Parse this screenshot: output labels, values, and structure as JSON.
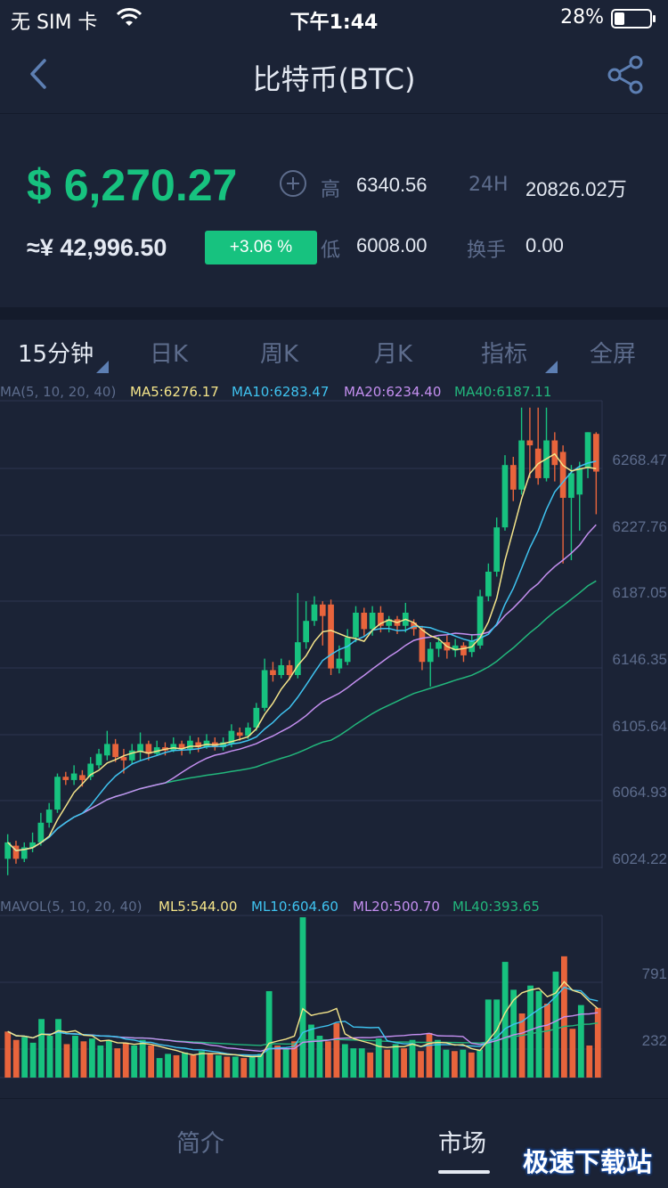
{
  "status_bar": {
    "carrier": "无 SIM 卡",
    "time": "下午1:44",
    "battery_pct": "28%",
    "battery_level": 0.28
  },
  "nav": {
    "title": "比特币(BTC)",
    "back_icon": "chevron-left-icon",
    "share_icon": "share-icon"
  },
  "price": {
    "main": "$ 6,270.27",
    "cny": "≈¥ 42,996.50",
    "change": "+3.06 %",
    "high_label": "高",
    "high_value": "6340.56",
    "low_label": "低",
    "low_value": "6008.00",
    "volume_label": "24H",
    "volume_value": "20826.02万",
    "turnover_label": "换手",
    "turnover_value": "0.00"
  },
  "period_tabs": [
    "15分钟",
    "日K",
    "周K",
    "月K",
    "指标",
    "全屏"
  ],
  "active_period": "15分钟",
  "colors": {
    "bg": "#1b2336",
    "up": "#17c27f",
    "down": "#e8643c",
    "ma5": "#f5e58a",
    "ma10": "#3fc3f0",
    "ma20": "#c48ff0",
    "ma40": "#22b77c",
    "grid": "#2c3650",
    "muted": "#5d6c8c"
  },
  "ma_legend": {
    "label": "MA(5, 10, 20, 40)",
    "ma5": "MA5:6276.17",
    "ma10": "MA10:6283.47",
    "ma20": "MA20:6234.40",
    "ma40": "MA40:6187.11"
  },
  "vol_legend": {
    "label": "MAVOL(5, 10, 20, 40)",
    "ml5": "ML5:544.00",
    "ml10": "ML10:604.60",
    "ml20": "ML20:500.70",
    "ml40": "ML40:393.65"
  },
  "chart_data": {
    "type": "candlestick",
    "price_axis_ticks": [
      "6268.47",
      "6227.76",
      "6187.05",
      "6146.35",
      "6105.64",
      "6064.93",
      "6024.22"
    ],
    "volume_axis_ticks": [
      "791",
      "232"
    ],
    "price_range": [
      6024.22,
      6309.18
    ],
    "volume_range": [
      0,
      1150
    ],
    "candles": [
      {
        "o": 6030,
        "c": 6040,
        "h": 6045,
        "l": 6020
      },
      {
        "o": 6038,
        "c": 6030,
        "h": 6041,
        "l": 6027
      },
      {
        "o": 6030,
        "c": 6037,
        "h": 6040,
        "l": 6028
      },
      {
        "o": 6037,
        "c": 6040,
        "h": 6046,
        "l": 6034
      },
      {
        "o": 6040,
        "c": 6052,
        "h": 6058,
        "l": 6038
      },
      {
        "o": 6052,
        "c": 6060,
        "h": 6064,
        "l": 6049
      },
      {
        "o": 6060,
        "c": 6080,
        "h": 6082,
        "l": 6058
      },
      {
        "o": 6080,
        "c": 6078,
        "h": 6083,
        "l": 6075
      },
      {
        "o": 6078,
        "c": 6082,
        "h": 6087,
        "l": 6075
      },
      {
        "o": 6081,
        "c": 6078,
        "h": 6084,
        "l": 6074
      },
      {
        "o": 6080,
        "c": 6088,
        "h": 6092,
        "l": 6078
      },
      {
        "o": 6087,
        "c": 6094,
        "h": 6097,
        "l": 6085
      },
      {
        "o": 6093,
        "c": 6100,
        "h": 6108,
        "l": 6090
      },
      {
        "o": 6100,
        "c": 6092,
        "h": 6103,
        "l": 6089
      },
      {
        "o": 6092,
        "c": 6090,
        "h": 6097,
        "l": 6082
      },
      {
        "o": 6090,
        "c": 6096,
        "h": 6100,
        "l": 6088
      },
      {
        "o": 6095,
        "c": 6100,
        "h": 6107,
        "l": 6090
      },
      {
        "o": 6100,
        "c": 6094,
        "h": 6102,
        "l": 6090
      },
      {
        "o": 6094,
        "c": 6098,
        "h": 6102,
        "l": 6093
      },
      {
        "o": 6098,
        "c": 6096,
        "h": 6101,
        "l": 6093
      },
      {
        "o": 6096,
        "c": 6100,
        "h": 6104,
        "l": 6095
      },
      {
        "o": 6100,
        "c": 6097,
        "h": 6102,
        "l": 6093
      },
      {
        "o": 6097,
        "c": 6102,
        "h": 6105,
        "l": 6094
      },
      {
        "o": 6101,
        "c": 6098,
        "h": 6104,
        "l": 6095
      },
      {
        "o": 6098,
        "c": 6102,
        "h": 6106,
        "l": 6097
      },
      {
        "o": 6101,
        "c": 6098,
        "h": 6104,
        "l": 6096
      },
      {
        "o": 6098,
        "c": 6101,
        "h": 6104,
        "l": 6096
      },
      {
        "o": 6100,
        "c": 6108,
        "h": 6112,
        "l": 6098
      },
      {
        "o": 6107,
        "c": 6105,
        "h": 6110,
        "l": 6102
      },
      {
        "o": 6105,
        "c": 6110,
        "h": 6113,
        "l": 6103
      },
      {
        "o": 6110,
        "c": 6122,
        "h": 6125,
        "l": 6108
      },
      {
        "o": 6122,
        "c": 6145,
        "h": 6152,
        "l": 6120
      },
      {
        "o": 6145,
        "c": 6142,
        "h": 6150,
        "l": 6138
      },
      {
        "o": 6142,
        "c": 6148,
        "h": 6152,
        "l": 6140
      },
      {
        "o": 6148,
        "c": 6142,
        "h": 6151,
        "l": 6139
      },
      {
        "o": 6142,
        "c": 6162,
        "h": 6192,
        "l": 6140
      },
      {
        "o": 6162,
        "c": 6175,
        "h": 6187,
        "l": 6158
      },
      {
        "o": 6175,
        "c": 6185,
        "h": 6190,
        "l": 6172
      },
      {
        "o": 6185,
        "c": 6178,
        "h": 6187,
        "l": 6160
      },
      {
        "o": 6185,
        "c": 6146,
        "h": 6188,
        "l": 6142
      },
      {
        "o": 6146,
        "c": 6152,
        "h": 6160,
        "l": 6143
      },
      {
        "o": 6150,
        "c": 6165,
        "h": 6170,
        "l": 6148
      },
      {
        "o": 6165,
        "c": 6180,
        "h": 6184,
        "l": 6162
      },
      {
        "o": 6180,
        "c": 6170,
        "h": 6183,
        "l": 6166
      },
      {
        "o": 6170,
        "c": 6180,
        "h": 6184,
        "l": 6166
      },
      {
        "o": 6180,
        "c": 6172,
        "h": 6184,
        "l": 6168
      },
      {
        "o": 6172,
        "c": 6176,
        "h": 6178,
        "l": 6168
      },
      {
        "o": 6176,
        "c": 6172,
        "h": 6178,
        "l": 6167
      },
      {
        "o": 6172,
        "c": 6180,
        "h": 6186,
        "l": 6168
      },
      {
        "o": 6174,
        "c": 6170,
        "h": 6176,
        "l": 6166
      },
      {
        "o": 6170,
        "c": 6150,
        "h": 6172,
        "l": 6145
      },
      {
        "o": 6150,
        "c": 6158,
        "h": 6162,
        "l": 6135
      },
      {
        "o": 6158,
        "c": 6162,
        "h": 6165,
        "l": 6153
      },
      {
        "o": 6162,
        "c": 6157,
        "h": 6166,
        "l": 6152
      },
      {
        "o": 6157,
        "c": 6160,
        "h": 6164,
        "l": 6153
      },
      {
        "o": 6160,
        "c": 6154,
        "h": 6162,
        "l": 6150
      },
      {
        "o": 6156,
        "c": 6163,
        "h": 6167,
        "l": 6153
      },
      {
        "o": 6160,
        "c": 6190,
        "h": 6194,
        "l": 6158
      },
      {
        "o": 6190,
        "c": 6205,
        "h": 6210,
        "l": 6187
      },
      {
        "o": 6205,
        "c": 6232,
        "h": 6238,
        "l": 6202
      },
      {
        "o": 6232,
        "c": 6270,
        "h": 6276,
        "l": 6230
      },
      {
        "o": 6270,
        "c": 6255,
        "h": 6275,
        "l": 6248
      },
      {
        "o": 6255,
        "c": 6285,
        "h": 6305,
        "l": 6252
      },
      {
        "o": 6285,
        "c": 6282,
        "h": 6305,
        "l": 6262
      },
      {
        "o": 6280,
        "c": 6262,
        "h": 6305,
        "l": 6258
      },
      {
        "o": 6262,
        "c": 6285,
        "h": 6305,
        "l": 6260
      },
      {
        "o": 6285,
        "c": 6270,
        "h": 6290,
        "l": 6260
      },
      {
        "o": 6278,
        "c": 6250,
        "h": 6282,
        "l": 6210
      },
      {
        "o": 6250,
        "c": 6265,
        "h": 6270,
        "l": 6212
      },
      {
        "o": 6252,
        "c": 6268,
        "h": 6272,
        "l": 6230
      },
      {
        "o": 6268,
        "c": 6290,
        "h": 6290,
        "l": 6262
      },
      {
        "o": 6289,
        "c": 6266,
        "h": 6290,
        "l": 6240
      }
    ],
    "volumes": [
      {
        "v": 330,
        "up": false
      },
      {
        "v": 270,
        "up": false
      },
      {
        "v": 290,
        "up": true
      },
      {
        "v": 250,
        "up": true
      },
      {
        "v": 420,
        "up": true
      },
      {
        "v": 300,
        "up": true
      },
      {
        "v": 420,
        "up": true
      },
      {
        "v": 240,
        "up": false
      },
      {
        "v": 300,
        "up": true
      },
      {
        "v": 260,
        "up": false
      },
      {
        "v": 280,
        "up": true
      },
      {
        "v": 230,
        "up": true
      },
      {
        "v": 270,
        "up": true
      },
      {
        "v": 210,
        "up": false
      },
      {
        "v": 250,
        "up": false
      },
      {
        "v": 230,
        "up": true
      },
      {
        "v": 270,
        "up": true
      },
      {
        "v": 230,
        "up": false
      },
      {
        "v": 140,
        "up": true
      },
      {
        "v": 170,
        "up": true
      },
      {
        "v": 160,
        "up": false
      },
      {
        "v": 180,
        "up": true
      },
      {
        "v": 160,
        "up": false
      },
      {
        "v": 190,
        "up": true
      },
      {
        "v": 170,
        "up": false
      },
      {
        "v": 160,
        "up": true
      },
      {
        "v": 150,
        "up": false
      },
      {
        "v": 150,
        "up": true
      },
      {
        "v": 140,
        "up": false
      },
      {
        "v": 150,
        "up": true
      },
      {
        "v": 170,
        "up": true
      },
      {
        "v": 620,
        "up": true
      },
      {
        "v": 230,
        "up": false
      },
      {
        "v": 210,
        "up": true
      },
      {
        "v": 260,
        "up": false
      },
      {
        "v": 1150,
        "up": true
      },
      {
        "v": 380,
        "up": true
      },
      {
        "v": 300,
        "up": true
      },
      {
        "v": 260,
        "up": false
      },
      {
        "v": 390,
        "up": false
      },
      {
        "v": 240,
        "up": true
      },
      {
        "v": 210,
        "up": true
      },
      {
        "v": 210,
        "up": true
      },
      {
        "v": 180,
        "up": false
      },
      {
        "v": 280,
        "up": true
      },
      {
        "v": 200,
        "up": false
      },
      {
        "v": 240,
        "up": true
      },
      {
        "v": 210,
        "up": false
      },
      {
        "v": 270,
        "up": true
      },
      {
        "v": 190,
        "up": false
      },
      {
        "v": 320,
        "up": false
      },
      {
        "v": 270,
        "up": true
      },
      {
        "v": 200,
        "up": true
      },
      {
        "v": 190,
        "up": false
      },
      {
        "v": 200,
        "up": true
      },
      {
        "v": 180,
        "up": false
      },
      {
        "v": 200,
        "up": true
      },
      {
        "v": 560,
        "up": true
      },
      {
        "v": 560,
        "up": true
      },
      {
        "v": 830,
        "up": true
      },
      {
        "v": 630,
        "up": true
      },
      {
        "v": 460,
        "up": false
      },
      {
        "v": 660,
        "up": true
      },
      {
        "v": 620,
        "up": true
      },
      {
        "v": 530,
        "up": false
      },
      {
        "v": 760,
        "up": true
      },
      {
        "v": 870,
        "up": false
      },
      {
        "v": 350,
        "up": false
      },
      {
        "v": 520,
        "up": true
      },
      {
        "v": 230,
        "up": false
      },
      {
        "v": 500,
        "up": false
      }
    ]
  },
  "bottom_tabs": [
    "简介",
    "市场"
  ],
  "active_bottom_tab": "市场",
  "watermark": "极速下载站"
}
